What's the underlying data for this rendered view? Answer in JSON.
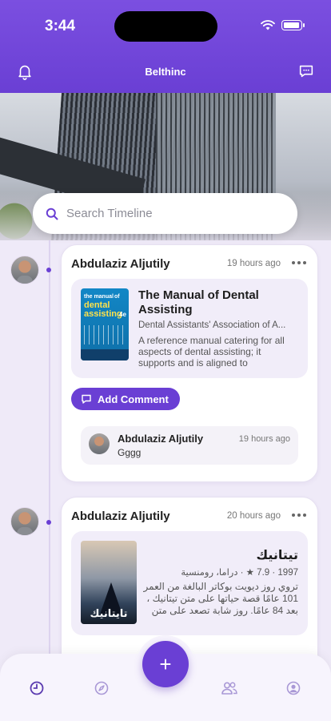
{
  "status_bar": {
    "time": "3:44"
  },
  "header": {
    "title": "Belthinc"
  },
  "search": {
    "placeholder": "Search Timeline"
  },
  "posts": [
    {
      "author": "Abdulaziz Aljutily",
      "time": "19 hours ago",
      "media": {
        "cover_lines": [
          "the manual",
          "of",
          "dental",
          "assisting",
          "4e"
        ],
        "title": "The Manual of Dental Assisting",
        "subtitle": "Dental Assistants' Association of A...",
        "description": "A reference manual catering for all aspects of dental assisting; it supports and is aligned to"
      },
      "comment_button": "Add Comment",
      "comments": [
        {
          "author": "Abdulaziz Aljutily",
          "time": "19 hours ago",
          "text": "Gggg"
        }
      ]
    },
    {
      "author": "Abdulaziz Aljutily",
      "time": "20 hours ago",
      "media": {
        "poster_title": "تايتانيك",
        "title": "تيتانيك",
        "meta": "1997 · 7.9 ★ · دراما، رومنسية",
        "description": "تروي روز ديويت بوكاتر البالغة من العمر 101 عامًا قصة حياتها على متن تيتانيك ، بعد 84 عامًا. روز شابة تصعد على متن"
      }
    }
  ],
  "nav": {
    "items": [
      "timeline-icon",
      "explore-icon",
      "fab-plus",
      "people-icon",
      "profile-icon"
    ],
    "fab_label": "+"
  },
  "colors": {
    "accent": "#6a3fd4",
    "header": "#7b4fe0"
  }
}
